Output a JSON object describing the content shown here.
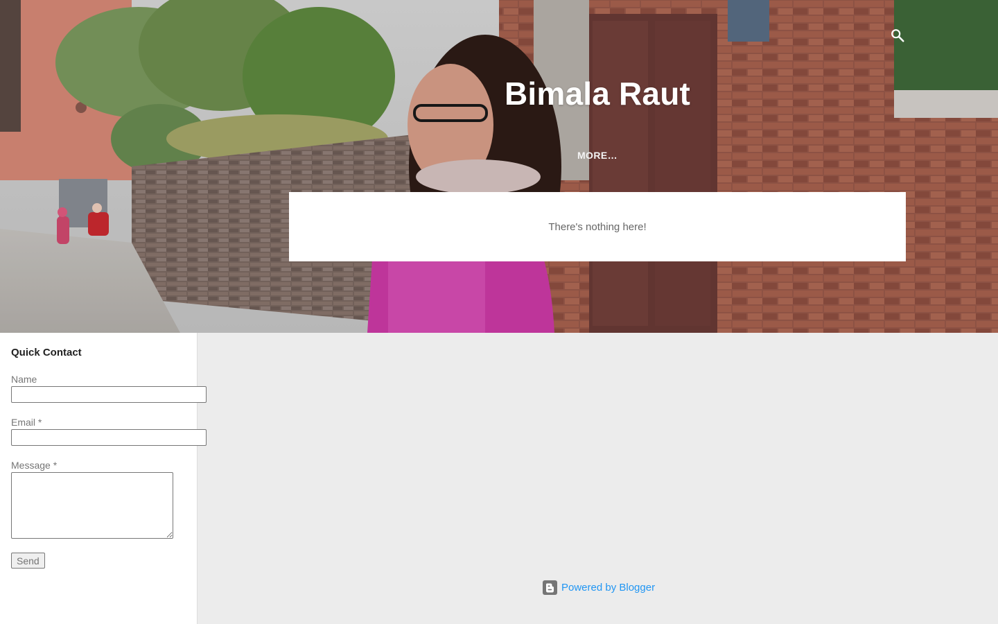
{
  "header": {
    "title": "Bimala Raut",
    "more_label": "MORE…",
    "search_icon": "search-icon"
  },
  "main": {
    "empty_message": "There's nothing here!"
  },
  "sidebar": {
    "widget_title": "Quick Contact",
    "fields": {
      "name_label": "Name",
      "name_value": "",
      "email_label": "Email *",
      "email_value": "",
      "message_label": "Message *",
      "message_value": ""
    },
    "send_label": "Send"
  },
  "footer": {
    "powered_label": "Powered by Blogger",
    "icon": "blogger-icon"
  },
  "colors": {
    "page_bg": "#ececec",
    "link": "#2196f3",
    "title": "#ffffff",
    "card_bg": "#ffffff"
  }
}
